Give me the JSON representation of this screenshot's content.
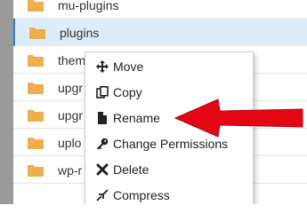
{
  "colors": {
    "folder": "#f0ad4e",
    "selected_row": "#dcecf8",
    "arrow": "#e30613"
  },
  "files": [
    {
      "name": "mu-plugins",
      "icon": "folder-icon"
    },
    {
      "name": "plugins",
      "icon": "folder-icon",
      "selected": true
    },
    {
      "name": "them",
      "icon": "folder-icon"
    },
    {
      "name": "upgr",
      "icon": "folder-icon"
    },
    {
      "name": "upgr",
      "icon": "folder-icon"
    },
    {
      "name": "uplo",
      "icon": "folder-icon"
    },
    {
      "name": "wp-r",
      "icon": "folder-icon"
    }
  ],
  "context_menu": {
    "items": [
      {
        "label": "Move",
        "icon": "move-icon"
      },
      {
        "label": "Copy",
        "icon": "copy-icon"
      },
      {
        "label": "Rename",
        "icon": "file-icon"
      },
      {
        "label": "Change Permissions",
        "icon": "key-icon"
      },
      {
        "label": "Delete",
        "icon": "x-icon"
      },
      {
        "label": "Compress",
        "icon": "compress-icon"
      }
    ]
  },
  "annotation": {
    "points_to": "Rename"
  }
}
